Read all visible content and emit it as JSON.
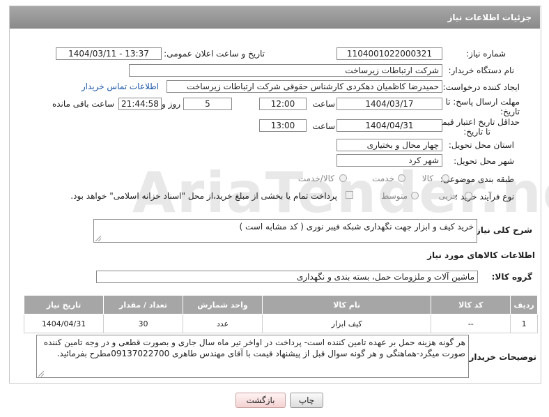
{
  "header": {
    "title": "جزئیات اطلاعات نیاز"
  },
  "fields": {
    "need_number_label": "شماره نیاز:",
    "need_number": "1104001022000321",
    "announce_label": "تاریخ و ساعت اعلان عمومی:",
    "announce_value": "1404/03/11 - 13:37",
    "buyer_org_label": "نام دستگاه خریدار:",
    "buyer_org": "شرکت ارتباطات زیرساخت",
    "requester_label": "ایجاد کننده درخواست:",
    "requester": "حمیدرضا کاظمیان دهکردی کارشناس حقوقی شرکت ارتباطات زیرساخت",
    "contact_link": "اطلاعات تماس خریدار",
    "deadline_label_1": "مهلت ارسال پاسخ: تا",
    "deadline_label_2": "تاریخ:",
    "deadline_date": "1404/03/17",
    "time_label": "ساعت",
    "deadline_time": "12:00",
    "days_value": "5",
    "days_label": "روز و",
    "remaining_time": "21:44:58",
    "remaining_label": "ساعت باقی مانده",
    "validity_label_1": "حداقل تاریخ اعتبار قیمت:",
    "validity_label_2": "تا تاریخ:",
    "validity_date": "1404/04/31",
    "validity_time": "13:00",
    "province_label": "استان محل تحویل:",
    "province": "چهار محال و بختیاری",
    "city_label": "شهر محل تحویل:",
    "city": "شهر کرد",
    "category_label": "طبقه بندی موضوعی:",
    "category_options": [
      "کالا",
      "خدمت",
      "کالا/خدمت"
    ],
    "process_label": "نوع فرآیند خرید :",
    "process_options": [
      "جزیی",
      "متوسط"
    ],
    "payment_note": "پرداخت تمام یا بخشی از مبلغ خرید،از محل \"اسناد خزانه اسلامی\" خواهد بود."
  },
  "description": {
    "label": "شرح کلی نیاز:",
    "text": "خرید کیف و ابزار جهت نگهداری شبکه فیبر نوری ( کد مشابه است )"
  },
  "goods": {
    "section_title": "اطلاعات کالاهای مورد نیاز",
    "group_label": "گروه کالا:",
    "group_value": "ماشین آلات و ملزومات حمل، بسته بندی و نگهداری",
    "columns": [
      "ردیف",
      "کد کالا",
      "نام کالا",
      "واحد شمارش",
      "تعداد / مقدار",
      "تاریخ نیاز"
    ],
    "rows": [
      [
        "1",
        "--",
        "کیف ابزار",
        "عدد",
        "30",
        "1404/04/31"
      ]
    ]
  },
  "buyer_notes": {
    "label": "توضیحات خریدار:",
    "text": "هر گونه هزینه حمل بر عهده تامین کننده است- پرداخت در اواخر تیر ماه سال جاری  و بصورت قطعی و در وجه تامین کننده صورت میگرد-هماهنگی و هر گونه سوال قبل از پیشنهاد قیمت  با آقای مهندس طاهری  09137022700مطرح بفرمائید."
  },
  "buttons": {
    "print": "چاپ",
    "back": "بازگشت"
  },
  "watermark": "AriaTender.net"
}
